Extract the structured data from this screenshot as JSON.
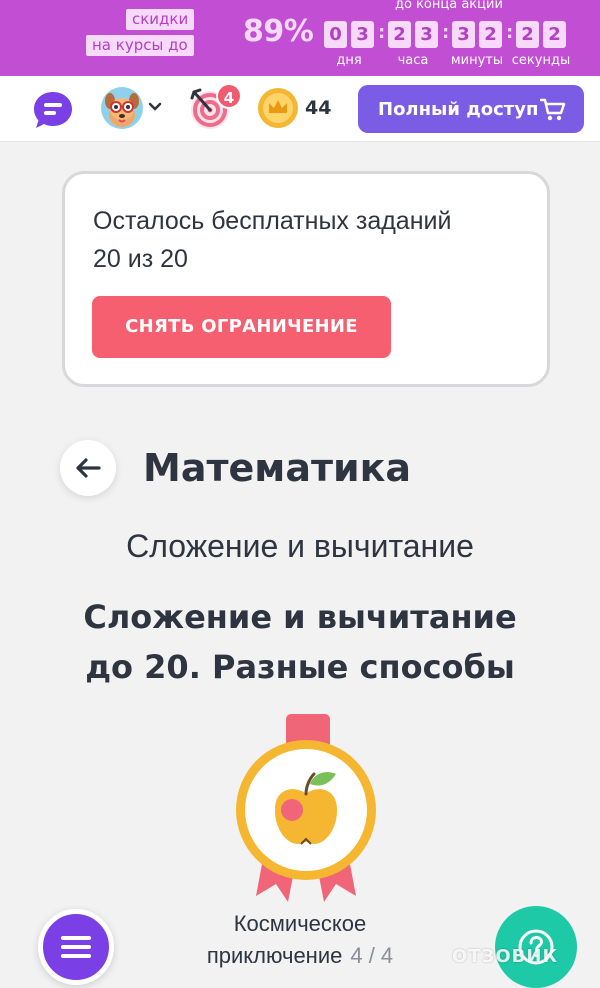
{
  "promo": {
    "tag_line1": "скидки",
    "tag_line2": "на курсы до",
    "discount": "89%",
    "countdown_caption": "до конца акции",
    "digits": [
      "0",
      "3",
      "2",
      "3",
      "3",
      "2",
      "2",
      "2"
    ],
    "units": {
      "days": "дня",
      "hours": "часа",
      "minutes": "минуты",
      "seconds": "секунды"
    }
  },
  "nav": {
    "target_badge": "4",
    "coins": "44",
    "full_access_label": "Полный доступ"
  },
  "free_tasks": {
    "text_line1": "Осталось бесплатных заданий",
    "text_line2": "20 из 20",
    "button_label": "СНЯТЬ ОГРАНИЧЕНИЕ"
  },
  "subject": {
    "title": "Математика",
    "section": "Сложение и вычитание",
    "lesson_line1": "Сложение и вычитание",
    "lesson_line2": "до 20. Разные способы"
  },
  "adventure": {
    "name_line1": "Космическое",
    "name_line2": "приключение",
    "progress": "4 / 4"
  },
  "watermark": "ОТЗОВИК",
  "colors": {
    "promo_bg": "#c24ed4",
    "accent_purple": "#7b5ce5",
    "button_red": "#f55f6f",
    "help_green": "#1dc9a6",
    "medal_gold": "#f5b731"
  }
}
